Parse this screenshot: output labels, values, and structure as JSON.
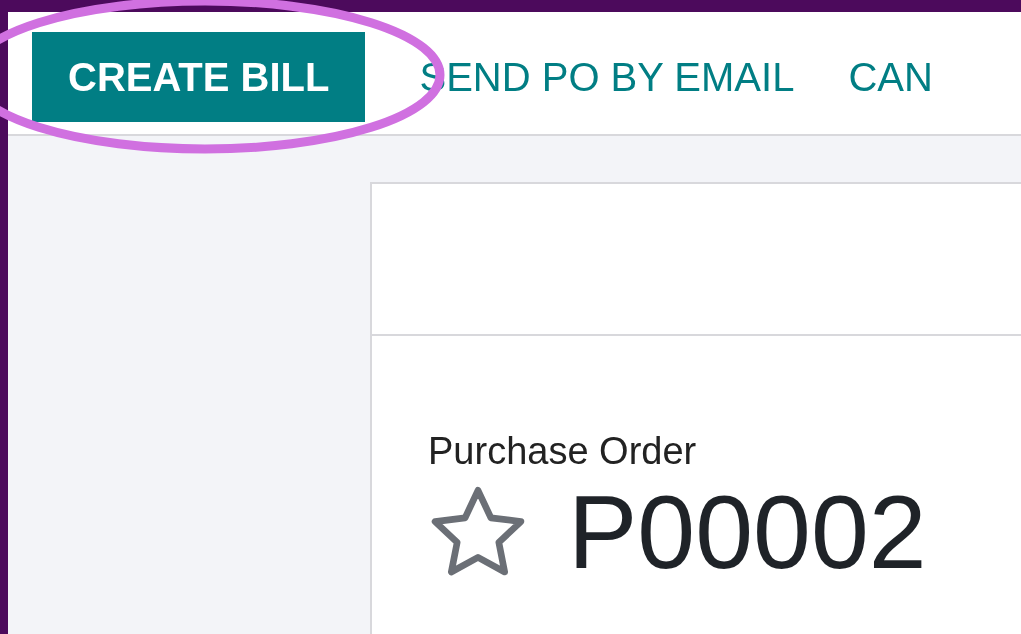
{
  "toolbar": {
    "buttons": [
      {
        "label": "CREATE BILL",
        "kind": "primary"
      },
      {
        "label": "SEND PO BY EMAIL",
        "kind": "link"
      },
      {
        "label": "CAN",
        "kind": "link"
      }
    ]
  },
  "annotation": {
    "kind": "ellipse",
    "color": "#d070e0"
  },
  "record": {
    "type_label": "Purchase Order",
    "name": "P00002",
    "favorite": false
  }
}
